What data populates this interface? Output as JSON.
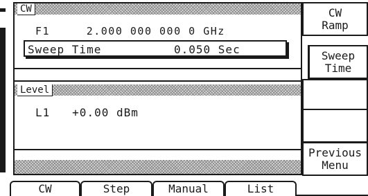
{
  "cw_panel": {
    "header": "CW",
    "frequency_label": "F1",
    "frequency_value": "2.000 000 000 0 GHz",
    "popup": {
      "label": "Sweep Time",
      "value": "0.050 Sec"
    }
  },
  "level_panel": {
    "header": "Level",
    "label": "L1",
    "value": "+0.00 dBm"
  },
  "softkeys": [
    {
      "line1": "CW",
      "line2": "Ramp"
    },
    {
      "line1": "Sweep",
      "line2": "Time"
    },
    {
      "line1": "",
      "line2": ""
    },
    {
      "line1": "",
      "line2": ""
    },
    {
      "line1": "Previous",
      "line2": "Menu"
    }
  ],
  "tabs": [
    "CW",
    "Step",
    "Manual",
    "List"
  ],
  "selected_tab": "CW"
}
